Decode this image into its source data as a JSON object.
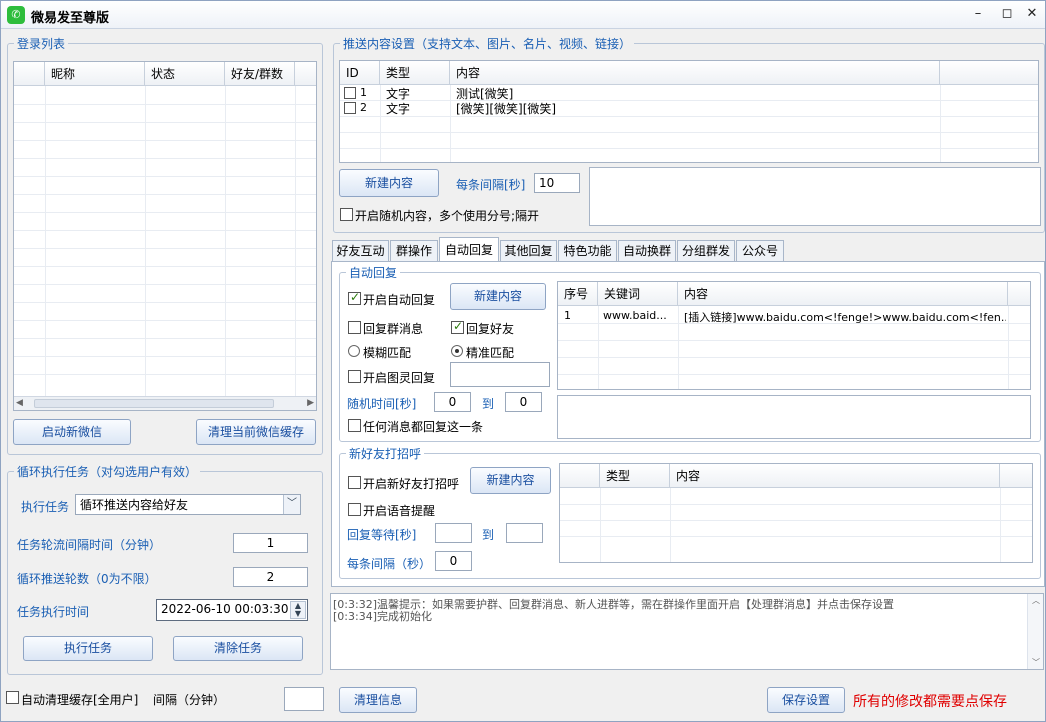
{
  "window": {
    "title": "微易发至尊版",
    "app_icon": "wechat-icon",
    "minimize": "–",
    "maximize": "◻",
    "close": "✕"
  },
  "login_list": {
    "title": "登录列表",
    "columns": [
      "昵称",
      "状态",
      "好友/群数"
    ],
    "start_button": "启动新微信",
    "clear_cache_button": "清理当前微信缓存"
  },
  "loop_task": {
    "title": "循环执行任务（对勾选用户有效）",
    "task_label": "执行任务",
    "task_value": "循环推送内容给好友",
    "interval_label": "任务轮流间隔时间（分钟）",
    "interval_value": "1",
    "rounds_label": "循环推送轮数（0为不限）",
    "rounds_value": "2",
    "time_label": "任务执行时间",
    "time_value": "2022-06-10 00:03:30",
    "run_button": "执行任务",
    "clear_button": "清除任务"
  },
  "auto_clean": {
    "label": "自动清理缓存[全用户]",
    "interval_label": "间隔（分钟）",
    "interval_value": ""
  },
  "push_settings": {
    "title": "推送内容设置（支持文本、图片、名片、视频、链接）",
    "columns": [
      "ID",
      "类型",
      "内容"
    ],
    "rows": [
      {
        "id": "1",
        "type": "文字",
        "content": "测试[微笑]"
      },
      {
        "id": "2",
        "type": "文字",
        "content": "[微笑][微笑][微笑]"
      }
    ],
    "new_button": "新建内容",
    "interval_label": "每条间隔[秒]",
    "interval_value": "10",
    "random_label": "开启随机内容，多个使用分号;隔开"
  },
  "tabs": [
    "好友互动",
    "群操作",
    "自动回复",
    "其他回复",
    "特色功能",
    "自动换群",
    "分组群发",
    "公众号"
  ],
  "auto_reply": {
    "title": "自动回复",
    "enable_label": "开启自动回复",
    "new_button": "新建内容",
    "group_msg_label": "回复群消息",
    "friend_label": "回复好友",
    "fuzzy_label": "模糊匹配",
    "exact_label": "精准匹配",
    "tuling_label": "开启图灵回复",
    "random_time_label": "随机时间[秒]",
    "random_from": "0",
    "to_label": "到",
    "random_to": "0",
    "any_msg_label": "任何消息都回复这一条",
    "columns": [
      "序号",
      "关键词",
      "内容"
    ],
    "rows": [
      {
        "no": "1",
        "keyword": "www.baid...",
        "content": "[插入链接]www.baidu.com<!fenge!>www.baidu.com<!fen..."
      }
    ]
  },
  "new_friend": {
    "title": "新好友打招呼",
    "enable_label": "开启新好友打招呼",
    "new_button": "新建内容",
    "voice_label": "开启语音提醒",
    "wait_label": "回复等待[秒]",
    "wait_from": "",
    "to_label": "到",
    "wait_to": "",
    "each_label": "每条间隔（秒）",
    "each_value": "0",
    "columns": [
      "类型",
      "内容"
    ]
  },
  "log": [
    "[0:3:32]温馨提示：如果需要护群、回复群消息、新人进群等，需在群操作里面开启【处理群消息】并点击保存设置",
    "[0:3:34]完成初始化"
  ],
  "footer": {
    "clear_button": "清理信息",
    "save_button": "保存设置",
    "warning": "所有的修改都需要点保存",
    "warning_color": "#e00000"
  }
}
